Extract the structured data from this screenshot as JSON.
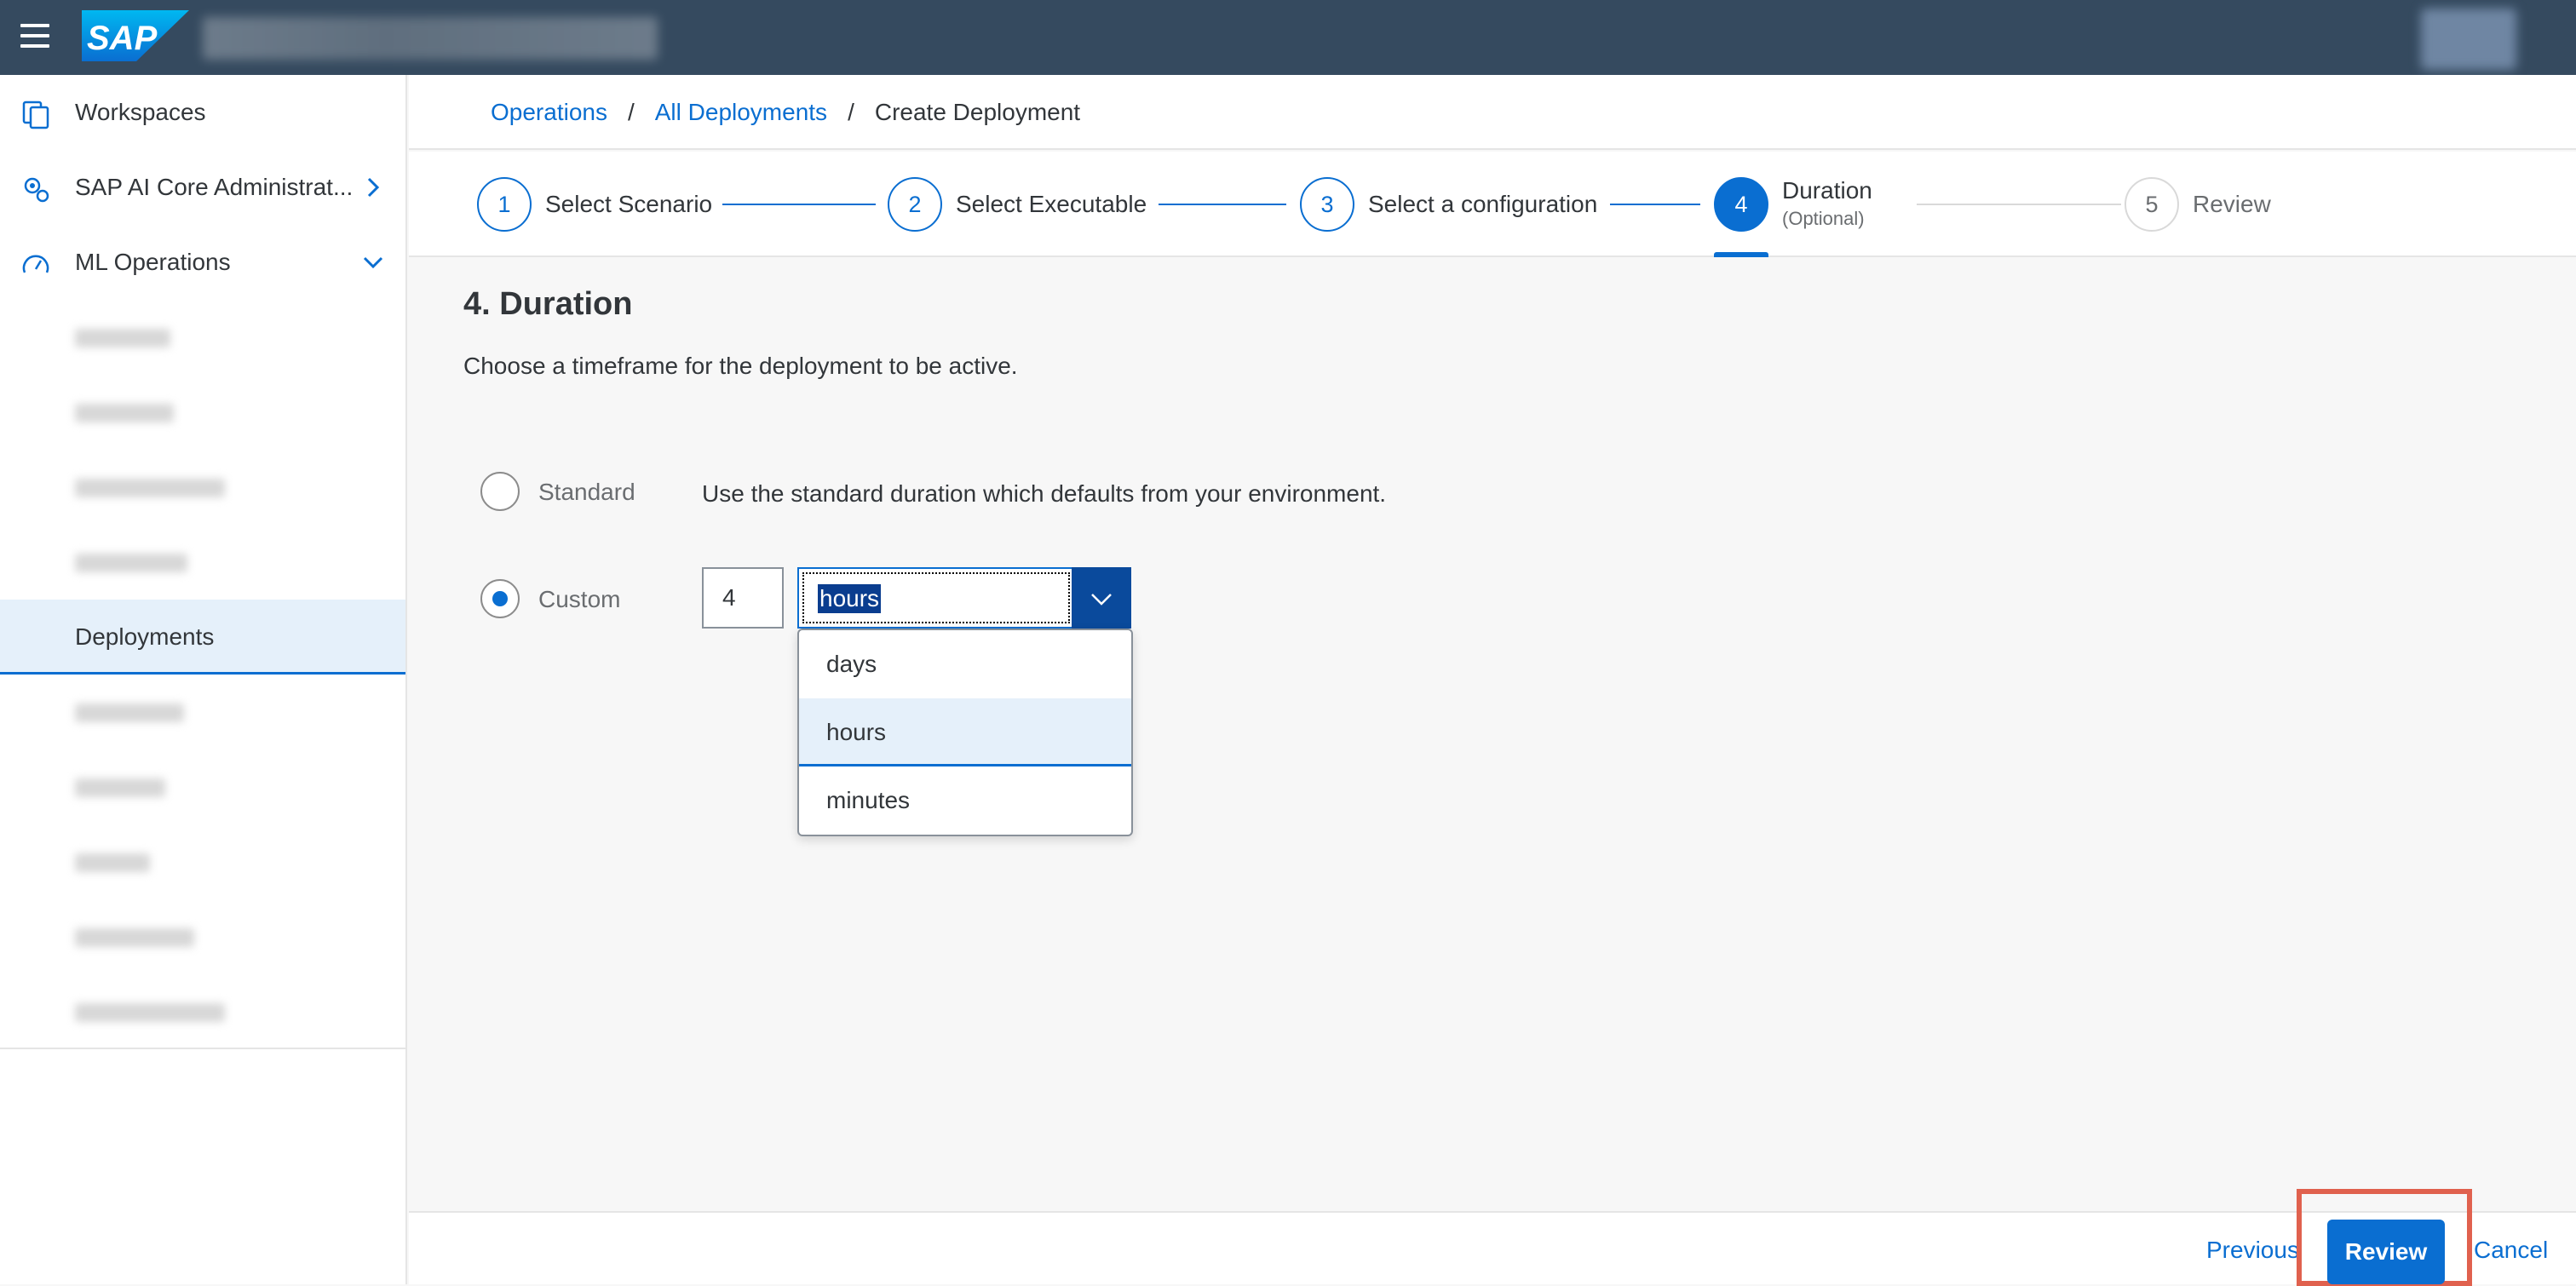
{
  "shell": {
    "logo_text": "SAP",
    "brand_color": "#0a6ed1",
    "header_color": "#354a5f"
  },
  "sidenav": {
    "items": [
      {
        "label": "Workspaces",
        "icon": "workspaces-icon"
      },
      {
        "label": "SAP AI Core Administrat...",
        "icon": "settings-icon"
      },
      {
        "label": "ML Operations",
        "icon": "gauge-icon"
      }
    ],
    "selected_label": "Deployments"
  },
  "breadcrumb": {
    "items": [
      "Operations",
      "All Deployments"
    ],
    "separator": "/",
    "current": "Create Deployment"
  },
  "wizard": {
    "steps": [
      {
        "number": "1",
        "label": "Select Scenario"
      },
      {
        "number": "2",
        "label": "Select Executable"
      },
      {
        "number": "3",
        "label": "Select a configuration"
      },
      {
        "number": "4",
        "label": "Duration",
        "sublabel": "(Optional)"
      },
      {
        "number": "5",
        "label": "Review"
      }
    ],
    "active_step": 4
  },
  "main": {
    "title": "4. Duration",
    "description": "Choose a timeframe for the deployment to be active.",
    "standard": {
      "label": "Standard",
      "description": "Use the standard duration which defaults from your environment."
    },
    "custom": {
      "label": "Custom",
      "value": "4",
      "unit": "hours"
    },
    "unit_options": [
      "days",
      "hours",
      "minutes"
    ],
    "selected_option": "hours"
  },
  "footer": {
    "previous": "Previous",
    "review": "Review",
    "cancel": "Cancel"
  }
}
